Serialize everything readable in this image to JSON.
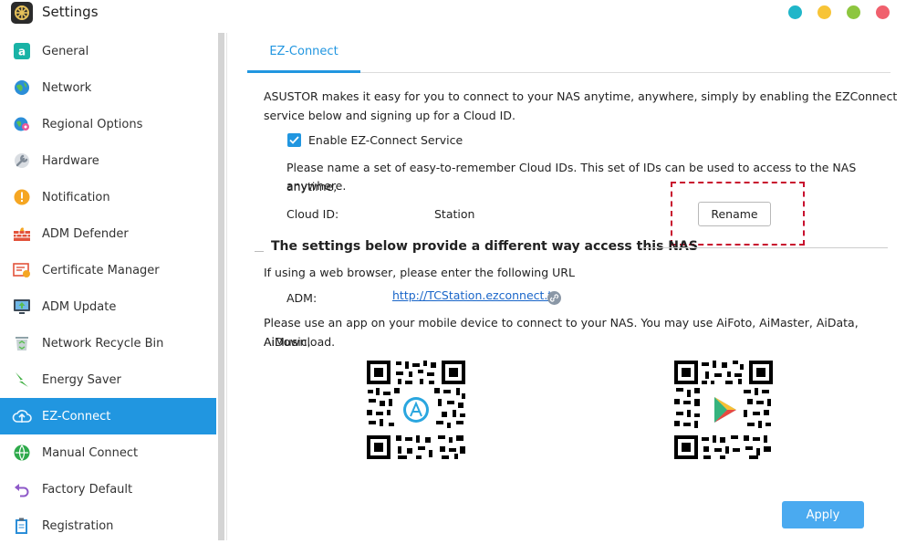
{
  "window": {
    "title": "Settings",
    "colors": {
      "accent": "#2196e0",
      "apply": "#4aaaf0",
      "link": "#1a66c9",
      "highlight": "#c8102e"
    }
  },
  "sidebar": {
    "items": [
      {
        "label": "General",
        "icon": "general-icon"
      },
      {
        "label": "Network",
        "icon": "globe-icon"
      },
      {
        "label": "Regional Options",
        "icon": "regional-icon"
      },
      {
        "label": "Hardware",
        "icon": "wrench-icon"
      },
      {
        "label": "Notification",
        "icon": "alert-icon"
      },
      {
        "label": "ADM Defender",
        "icon": "firewall-icon"
      },
      {
        "label": "Certificate Manager",
        "icon": "certificate-icon"
      },
      {
        "label": "ADM Update",
        "icon": "update-icon"
      },
      {
        "label": "Network Recycle Bin",
        "icon": "recycle-icon"
      },
      {
        "label": "Energy Saver",
        "icon": "energy-icon"
      },
      {
        "label": "EZ-Connect",
        "icon": "cloud-icon",
        "active": true
      },
      {
        "label": "Manual Connect",
        "icon": "connect-icon"
      },
      {
        "label": "Factory Default",
        "icon": "undo-icon"
      },
      {
        "label": "Registration",
        "icon": "clipboard-icon"
      }
    ]
  },
  "main": {
    "tab": "EZ-Connect",
    "intro_line1": "ASUSTOR makes it easy for you to connect to your NAS anytime, anywhere, simply by enabling the EZConnect",
    "intro_line2": "service below and signing up for a Cloud ID.",
    "enable_label": "Enable EZ-Connect Service",
    "enable_checked": true,
    "cloud_desc_line1": "Please name a set of easy-to-remember Cloud IDs. This set of IDs can be used to access to the NAS anytime,",
    "cloud_desc_line2": "anywhere.",
    "cloud_id_label": "Cloud ID:",
    "cloud_id_value": "Station",
    "rename_button": "Rename",
    "section_title": "The settings below provide a different way access this NAS",
    "browser_text": "If using a web browser, please enter the following URL",
    "adm_label": "ADM:",
    "adm_url": "http://TCStation.ezconnect.to",
    "app_line1": "Please use an app on your mobile device to connect to your NAS. You may use AiFoto, AiMaster, AiData, AiMusic,",
    "app_line2": "AiDownload.",
    "qr_codes": [
      {
        "store": "app-store",
        "icon": "app-store-icon"
      },
      {
        "store": "google-play",
        "icon": "google-play-icon"
      }
    ],
    "apply_button": "Apply"
  }
}
